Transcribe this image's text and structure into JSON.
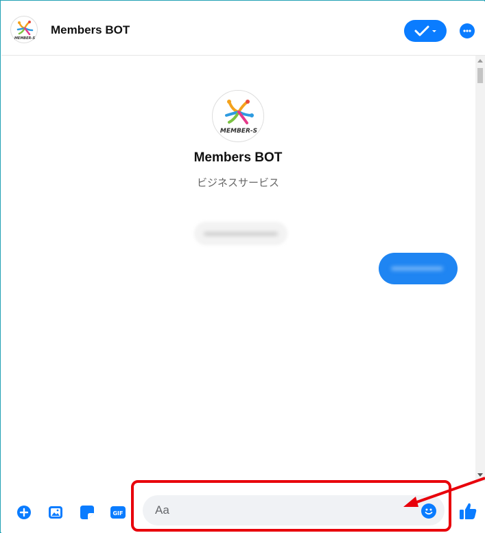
{
  "header": {
    "title": "Members BOT"
  },
  "profile": {
    "name": "Members BOT",
    "category": "ビジネスサービス",
    "logo_text": "MEMBER-S"
  },
  "composer": {
    "placeholder": "Aa"
  },
  "tools": {
    "gif_label": "GIF"
  },
  "colors": {
    "accent": "#0a7cff",
    "highlight": "#e8000b",
    "frame": "#20a0b4"
  }
}
